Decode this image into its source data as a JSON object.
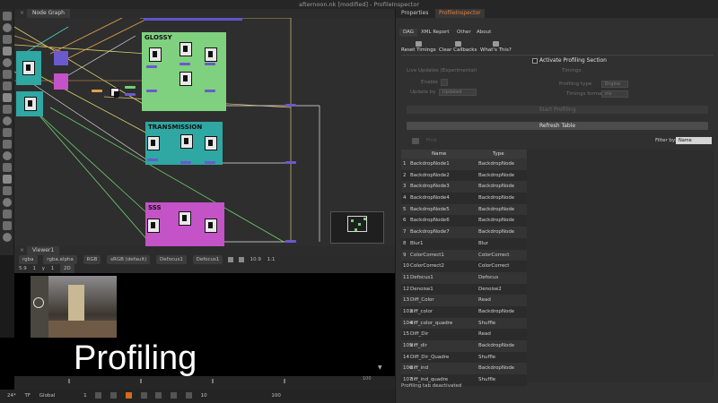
{
  "window": {
    "title": "afternoon.nk [modified] - ProfileInspector"
  },
  "node_graph": {
    "tab_label": "Node Graph",
    "backdrops": [
      {
        "label": "GLOSSY",
        "color": "#7fd07f"
      },
      {
        "label": "TRANSMISSION",
        "color": "#2fa7a3"
      },
      {
        "label": "SSS",
        "color": "#c353c6"
      }
    ]
  },
  "viewer": {
    "tab_label": "Viewer1",
    "bar1": {
      "channels": "rgba",
      "layer": "rgba.alpha",
      "colorspace": "RGB",
      "view_transform": "sRGB (default)",
      "input_a": "Defocus1",
      "input_b": "Defocus1",
      "zoom": "10.9",
      "ratio": "1:1"
    },
    "bar2": {
      "fstop": "5.9",
      "gamma_label": "1",
      "y_label": "y",
      "y_val": "1",
      "mode": "2D"
    }
  },
  "overlay_caption": "Profiling",
  "timeline": {
    "end_frame": "100",
    "fps": "24*",
    "tf": "TF",
    "scope": "Global",
    "frame_start": "1",
    "frame_end": "100",
    "step": "10",
    "current": "100"
  },
  "right_panel": {
    "tabs": [
      "Properties",
      "ProfileInspector"
    ],
    "active_tab": "ProfileInspector",
    "subtabs": [
      "DAG",
      "XML Report",
      "Other",
      "About"
    ],
    "active_subtab": "DAG",
    "actions": [
      "Reset Timings",
      "Clear Callbacks",
      "What's This?"
    ],
    "activate_checkbox": "Activate Profiling Section",
    "live_updates_label": "Live Updates (Experimental)",
    "enable_label": "Enable",
    "update_by_label": "Update by",
    "update_by_value": "Updated",
    "timings_label": "Timings",
    "profiling_type_label": "Profiling type",
    "profiling_type_value": "Engine",
    "timings_format_label": "Timings format",
    "timings_format_value": "ms",
    "start_button": "Start Profiling",
    "refresh_button": "Refresh Table",
    "find_placeholder": "Find",
    "filter_label": "Filter by:",
    "filter_value": "Name",
    "table": {
      "headers": [
        "Name",
        "Type"
      ],
      "rows": [
        [
          "1",
          "BackdropNode1",
          "BackdropNode"
        ],
        [
          "2",
          "BackdropNode2",
          "BackdropNode"
        ],
        [
          "3",
          "BackdropNode3",
          "BackdropNode"
        ],
        [
          "4",
          "BackdropNode4",
          "BackdropNode"
        ],
        [
          "5",
          "BackdropNode5",
          "BackdropNode"
        ],
        [
          "6",
          "BackdropNode6",
          "BackdropNode"
        ],
        [
          "7",
          "BackdropNode7",
          "BackdropNode"
        ],
        [
          "8",
          "Blur1",
          "Blur"
        ],
        [
          "9",
          "ColorCorrect1",
          "ColorCorrect"
        ],
        [
          "10",
          "ColorCorrect2",
          "ColorCorrect"
        ],
        [
          "11",
          "Defocus1",
          "Defocus"
        ],
        [
          "12",
          "Denoise1",
          "Denoise2"
        ],
        [
          "13",
          "Diff_Color",
          "Read"
        ],
        [
          "103",
          "diff_color",
          "BackdropNode"
        ],
        [
          "104",
          "diff_color_quadre",
          "Shuffle"
        ],
        [
          "15",
          "Diff_Dir",
          "Read"
        ],
        [
          "105",
          "diff_dir",
          "BackdropNode"
        ],
        [
          "14",
          "Diff_Dir_Quadre",
          "Shuffle"
        ],
        [
          "106",
          "diff_ind",
          "BackdropNode"
        ],
        [
          "107",
          "diff_ind_quadre",
          "Shuffle"
        ]
      ]
    },
    "status": "Profiling tab deactivated"
  }
}
